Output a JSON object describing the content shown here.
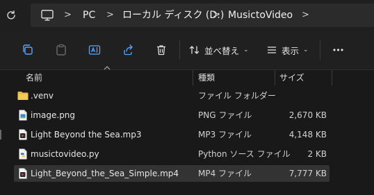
{
  "address_bar": {
    "crumbs": [
      "PC",
      "ローカル ディスク (D:)",
      "MusictoVideo"
    ],
    "separator": ">"
  },
  "toolbar": {
    "sort_label": "並べ替え",
    "view_label": "表示",
    "more_label": "•••",
    "chevron": "⌄"
  },
  "columns": {
    "name": "名前",
    "type": "種類",
    "size": "サイズ"
  },
  "files": [
    {
      "name": ".venv",
      "type": "ファイル フォルダー",
      "size": "",
      "icon": "folder-icon"
    },
    {
      "name": "image.png",
      "type": "PNG ファイル",
      "size": "2,670 KB",
      "icon": "image-file-icon"
    },
    {
      "name": "Light Beyond the Sea.mp3",
      "type": "MP3 ファイル",
      "size": "4,148 KB",
      "icon": "audio-file-icon"
    },
    {
      "name": "musictovideo.py",
      "type": "Python ソース ファイル",
      "size": "2 KB",
      "icon": "python-file-icon"
    },
    {
      "name": "Light_Beyond_the_Sea_Simple.mp4",
      "type": "MP4 ファイル",
      "size": "7,777 KB",
      "icon": "video-file-icon",
      "selected": true
    }
  ]
}
